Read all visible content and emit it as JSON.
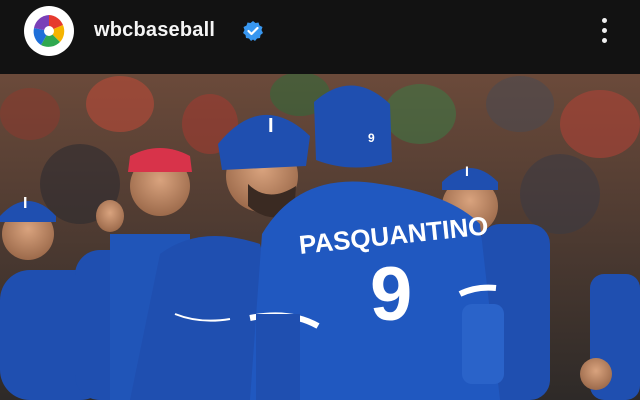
{
  "header": {
    "username": "wbcbaseball",
    "verified": true,
    "verified_icon": "verified-badge-icon",
    "more_icon": "more-options-icon",
    "avatar_icon": "wbc-logo-icon"
  },
  "photo": {
    "jersey_name": "PASQUANTINO",
    "jersey_number": "9",
    "cap_letter": "I",
    "helmet_number": "9",
    "colors": {
      "jersey_blue": "#1f4fb0",
      "jersey_text": "#ffffff",
      "crowd": "#5a3a2a"
    }
  },
  "colors": {
    "background": "#121212",
    "text": "#f5f5f5",
    "verified": "#3897f0"
  }
}
